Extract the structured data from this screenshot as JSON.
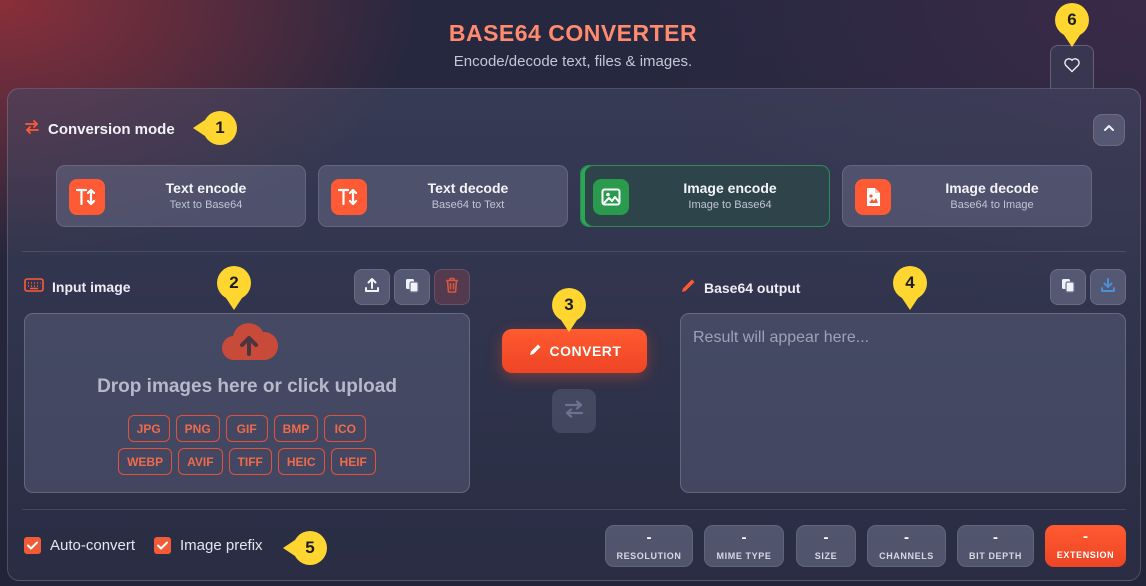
{
  "header": {
    "title": "BASE64 CONVERTER",
    "subtitle": "Encode/decode text, files & images."
  },
  "mode": {
    "title": "Conversion mode",
    "cards": [
      {
        "label": "Text encode",
        "sub": "Text to Base64",
        "icon": "text-size-icon",
        "active": false
      },
      {
        "label": "Text decode",
        "sub": "Base64 to Text",
        "icon": "text-size-icon",
        "active": false
      },
      {
        "label": "Image encode",
        "sub": "Image to Base64",
        "icon": "image-icon",
        "active": true
      },
      {
        "label": "Image decode",
        "sub": "Base64 to Image",
        "icon": "file-image-icon",
        "active": false
      }
    ]
  },
  "input": {
    "label": "Input image",
    "drop_text": "Drop images here or click upload",
    "formats_row1": [
      "JPG",
      "PNG",
      "GIF",
      "BMP",
      "ICO"
    ],
    "formats_row2": [
      "WEBP",
      "AVIF",
      "TIFF",
      "HEIC",
      "HEIF"
    ]
  },
  "convert": {
    "label": "CONVERT"
  },
  "output": {
    "label": "Base64 output",
    "placeholder": "Result will appear here..."
  },
  "options": {
    "auto_convert": {
      "label": "Auto-convert",
      "checked": true
    },
    "image_prefix": {
      "label": "Image prefix",
      "checked": true
    }
  },
  "stats": [
    {
      "value": "-",
      "label": "RESOLUTION"
    },
    {
      "value": "-",
      "label": "MIME TYPE"
    },
    {
      "value": "-",
      "label": "SIZE"
    },
    {
      "value": "-",
      "label": "CHANNELS"
    },
    {
      "value": "-",
      "label": "BIT DEPTH"
    },
    {
      "value": "-",
      "label": "EXTENSION",
      "highlight": true
    }
  ],
  "annotations": [
    "1",
    "2",
    "3",
    "4",
    "5",
    "6"
  ],
  "colors": {
    "accent": "#ff5a36",
    "active": "#2a9a4c",
    "badge": "#ffd630"
  }
}
